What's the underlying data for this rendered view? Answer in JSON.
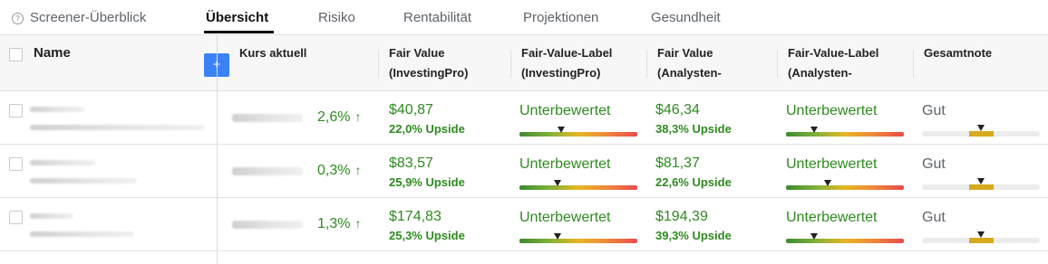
{
  "tabs": [
    {
      "label": "Screener-Überblick",
      "active": false
    },
    {
      "label": "Übersicht",
      "active": true
    },
    {
      "label": "Risiko",
      "active": false
    },
    {
      "label": "Rentabilität",
      "active": false
    },
    {
      "label": "Projektionen",
      "active": false
    },
    {
      "label": "Gesundheit",
      "active": false
    }
  ],
  "table": {
    "add_column_label": "+",
    "headers": {
      "name": "Name",
      "kurs": "Kurs aktuell",
      "fv_pro_1": "Fair Value",
      "fv_pro_2": "(InvestingPro)",
      "fvl_pro_1": "Fair-Value-Label",
      "fvl_pro_2": "(InvestingPro)",
      "fv_an_1": "Fair Value",
      "fv_an_2": "(Analysten-",
      "fvl_an_1": "Fair-Value-Label",
      "fvl_an_2": "(Analysten-",
      "gesamt": "Gesamtnote"
    },
    "rows": [
      {
        "change": "2,6%",
        "fv_pro": "$40,87",
        "fv_pro_upside": "22,0% Upside",
        "fv_pro_label": "Unterbewertet",
        "fv_pro_level": 0.35,
        "fv_an": "$46,34",
        "fv_an_upside": "38,3% Upside",
        "fv_an_label": "Unterbewertet",
        "fv_an_level": 0.24,
        "grade": "Gut"
      },
      {
        "change": "0,3%",
        "fv_pro": "$83,57",
        "fv_pro_upside": "25,9% Upside",
        "fv_pro_label": "Unterbewertet",
        "fv_pro_level": 0.32,
        "fv_an": "$81,37",
        "fv_an_upside": "22,6% Upside",
        "fv_an_label": "Unterbewertet",
        "fv_an_level": 0.35,
        "grade": "Gut"
      },
      {
        "change": "1,3%",
        "fv_pro": "$174,83",
        "fv_pro_upside": "25,3% Upside",
        "fv_pro_label": "Unterbewertet",
        "fv_pro_level": 0.32,
        "fv_an": "$194,39",
        "fv_an_upside": "39,3% Upside",
        "fv_an_label": "Unterbewertet",
        "fv_an_level": 0.24,
        "grade": "Gut"
      }
    ]
  },
  "icons": {
    "info": "question-circle-icon",
    "up": "arrow-up-icon"
  },
  "colors": {
    "positive": "#2e8b1f",
    "accent": "#3b82f6",
    "grade": "#d7aa1e"
  }
}
